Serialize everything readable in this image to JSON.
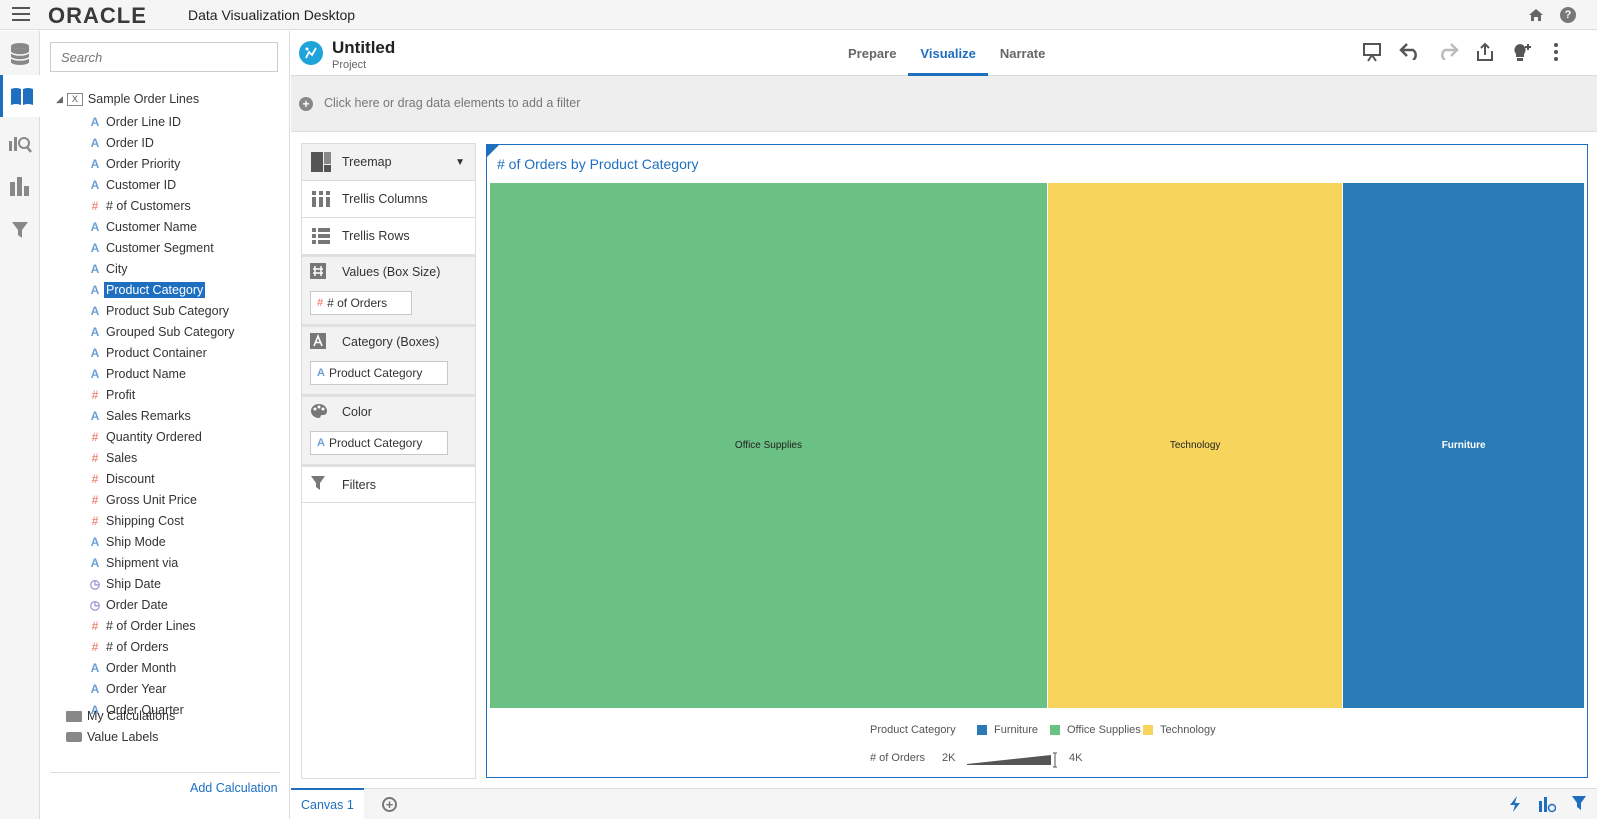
{
  "app": {
    "logo": "ORACLE",
    "title": "Data Visualization Desktop",
    "home_icon": "home-icon",
    "help_icon": "help-icon",
    "help_glyph": "?"
  },
  "rail": {
    "items": [
      "data-icon",
      "visualize-book-icon",
      "explore-icon",
      "chart-icon",
      "filter-icon"
    ]
  },
  "data_panel": {
    "search_placeholder": "Search",
    "source": "Sample Order Lines",
    "elements": [
      {
        "label": "Order Line ID",
        "type": "attr"
      },
      {
        "label": "Order ID",
        "type": "attr"
      },
      {
        "label": "Order Priority",
        "type": "attr"
      },
      {
        "label": "Customer ID",
        "type": "attr"
      },
      {
        "label": "# of Customers",
        "type": "meas"
      },
      {
        "label": "Customer Name",
        "type": "attr"
      },
      {
        "label": "Customer Segment",
        "type": "attr"
      },
      {
        "label": "City",
        "type": "attr"
      },
      {
        "label": "Product Category",
        "type": "attr",
        "selected": true
      },
      {
        "label": "Product Sub Category",
        "type": "attr"
      },
      {
        "label": "Grouped Sub Category",
        "type": "attr"
      },
      {
        "label": "Product Container",
        "type": "attr"
      },
      {
        "label": "Product Name",
        "type": "attr"
      },
      {
        "label": "Profit",
        "type": "meas"
      },
      {
        "label": "Sales Remarks",
        "type": "attr"
      },
      {
        "label": "Quantity Ordered",
        "type": "meas"
      },
      {
        "label": "Sales",
        "type": "meas"
      },
      {
        "label": "Discount",
        "type": "meas"
      },
      {
        "label": "Gross Unit Price",
        "type": "meas"
      },
      {
        "label": "Shipping Cost",
        "type": "meas"
      },
      {
        "label": "Ship Mode",
        "type": "attr"
      },
      {
        "label": "Shipment via",
        "type": "attr"
      },
      {
        "label": "Ship Date",
        "type": "time"
      },
      {
        "label": "Order Date",
        "type": "time"
      },
      {
        "label": "# of Order Lines",
        "type": "meas"
      },
      {
        "label": "# of Orders",
        "type": "meas"
      },
      {
        "label": "Order Month",
        "type": "attr"
      },
      {
        "label": "Order Year",
        "type": "attr"
      },
      {
        "label": "Order Quarter",
        "type": "attr"
      }
    ],
    "my_calculations": "My Calculations",
    "value_labels": "Value Labels",
    "add_calculation": "Add Calculation"
  },
  "project": {
    "title": "Untitled",
    "subtitle": "Project",
    "tabs": [
      {
        "label": "Prepare",
        "active": false
      },
      {
        "label": "Visualize",
        "active": true
      },
      {
        "label": "Narrate",
        "active": false
      }
    ]
  },
  "filter_bar": {
    "placeholder": "Click here or drag data elements to add a filter"
  },
  "grammar": {
    "viz_type": "Treemap",
    "trellis_columns": "Trellis Columns",
    "trellis_rows": "Trellis Rows",
    "values_label": "Values (Box Size)",
    "values_pill": "# of Orders",
    "category_label": "Category (Boxes)",
    "category_pill": "Product Category",
    "color_label": "Color",
    "color_pill": "Product Category",
    "filters_label": "Filters"
  },
  "chart_data": {
    "type": "treemap",
    "title": "# of Orders by Product Category",
    "categories": [
      "Office Supplies",
      "Technology",
      "Furniture"
    ],
    "values": [
      51,
      27,
      22
    ],
    "value_unit": "share of # of Orders (%)",
    "colors": [
      "#6bc084",
      "#f7d55c",
      "#2a7ab6"
    ],
    "label_colors": [
      "#222222",
      "#222222",
      "#ffffff"
    ],
    "legend": {
      "title": "Product Category",
      "items": [
        {
          "label": "Furniture",
          "color": "#2a7ab6"
        },
        {
          "label": "Office Supplies",
          "color": "#6bc084"
        },
        {
          "label": "Technology",
          "color": "#f7d55c"
        }
      ]
    },
    "size_legend": {
      "title": "# of Orders",
      "min_label": "2K",
      "max_label": "4K"
    }
  },
  "bottom": {
    "canvas_tab": "Canvas 1",
    "add_canvas_glyph": "+"
  }
}
